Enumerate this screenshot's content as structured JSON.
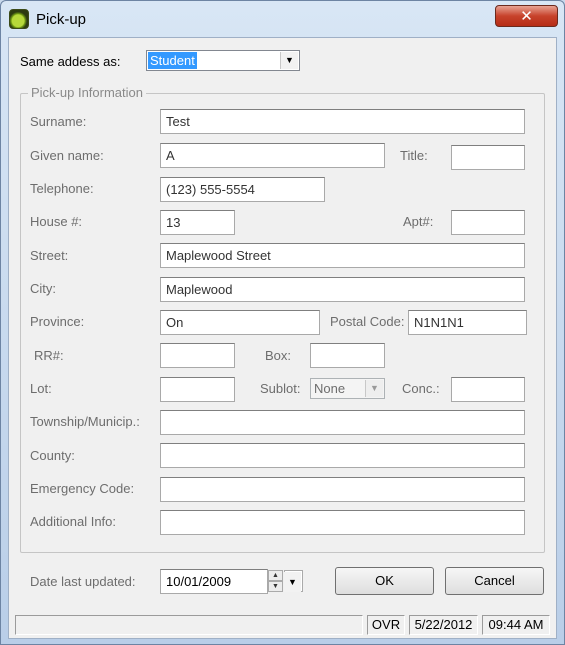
{
  "window": {
    "title": "Pick-up",
    "close_glyph": "✕"
  },
  "same_address": {
    "label": "Same addess as:",
    "value": "Student"
  },
  "group": {
    "title": "Pick-up Information"
  },
  "fields": {
    "surname": {
      "label": "Surname:",
      "value": "Test"
    },
    "given_name": {
      "label": "Given name:",
      "value": "A"
    },
    "title": {
      "label": "Title:",
      "value": ""
    },
    "telephone": {
      "label": "Telephone:",
      "value": "(123) 555-5554"
    },
    "house": {
      "label": "House #:",
      "value": "13"
    },
    "apt": {
      "label": "Apt#:",
      "value": ""
    },
    "street": {
      "label": "Street:",
      "value": "Maplewood Street"
    },
    "city": {
      "label": "City:",
      "value": "Maplewood"
    },
    "province": {
      "label": "Province:",
      "value": "On"
    },
    "postal_code": {
      "label": "Postal Code:",
      "value": "N1N1N1"
    },
    "rr": {
      "label": "RR#:",
      "value": ""
    },
    "box": {
      "label": "Box:",
      "value": ""
    },
    "lot": {
      "label": "Lot:",
      "value": ""
    },
    "sublot": {
      "label": "Sublot:",
      "value": "None"
    },
    "conc": {
      "label": "Conc.:",
      "value": ""
    },
    "township": {
      "label": "Township/Municip.:",
      "value": ""
    },
    "county": {
      "label": "County:",
      "value": ""
    },
    "emergency_code": {
      "label": "Emergency Code:",
      "value": ""
    },
    "additional_info": {
      "label": "Additional Info:",
      "value": ""
    }
  },
  "date_updated": {
    "label": "Date last updated:",
    "value": "10/01/2009"
  },
  "buttons": {
    "ok": "OK",
    "cancel": "Cancel"
  },
  "status": {
    "mode": "OVR",
    "date": "5/22/2012",
    "time": "09:44 AM"
  },
  "icons": {
    "app": "green-ball-icon",
    "close": "close-icon",
    "dropdown": "chevron-down-icon",
    "spin_up": "spin-up-icon",
    "spin_down": "spin-down-icon"
  },
  "colors": {
    "selection": "#3399ff",
    "close_button": "#c7422b",
    "window_frame": "#b9cee8"
  }
}
